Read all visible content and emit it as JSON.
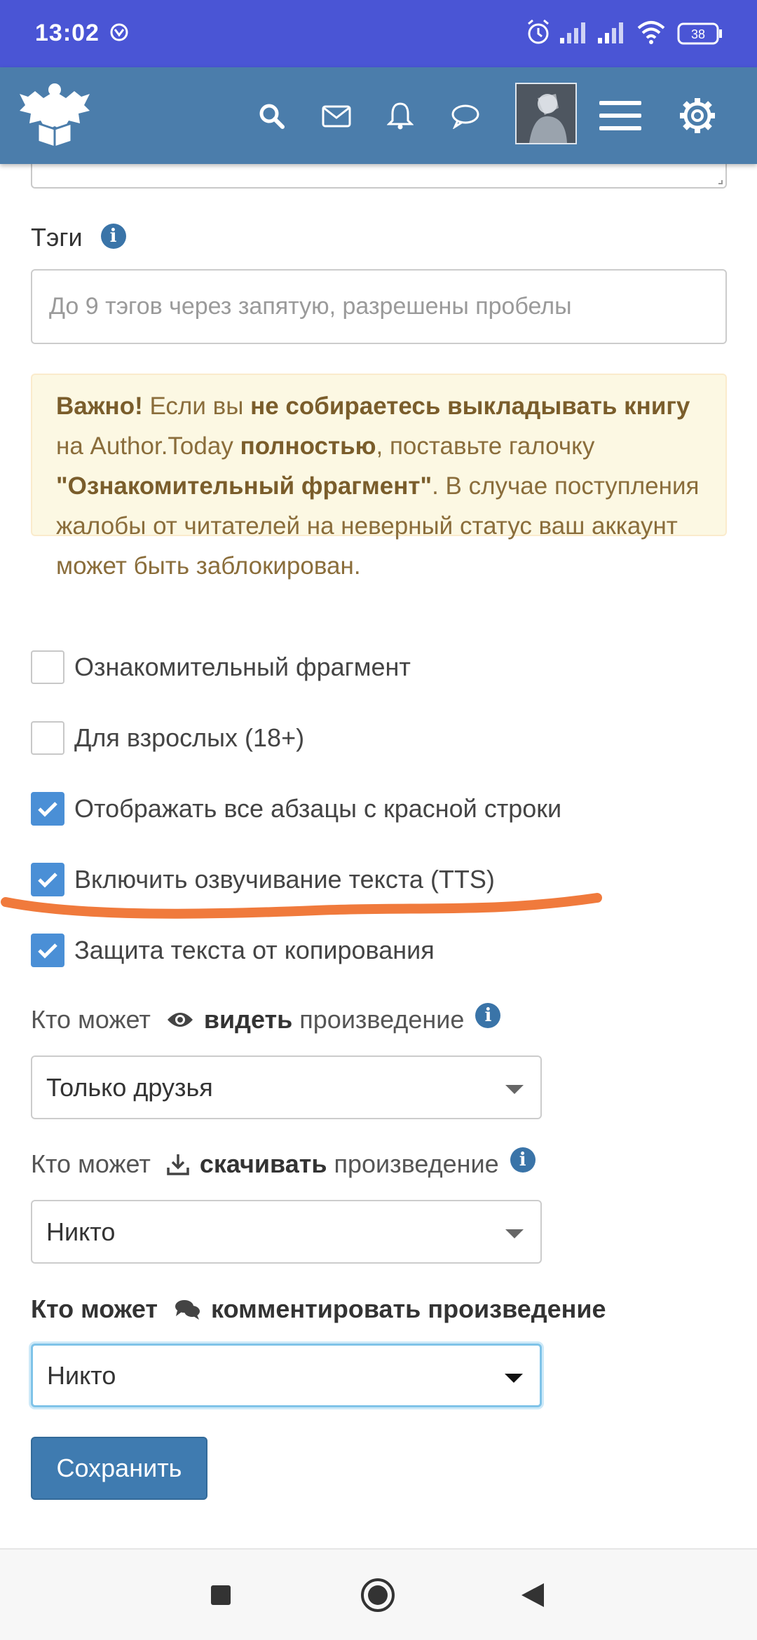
{
  "status_bar": {
    "time": "13:02",
    "battery": "38"
  },
  "header": {
    "nav_icons": [
      "search-icon",
      "mail-icon",
      "bell-icon",
      "chat-icon",
      "avatar",
      "menu-icon",
      "gear-icon"
    ]
  },
  "form": {
    "tags": {
      "label": "Тэги",
      "placeholder": "До 9 тэгов через запятую, разрешены пробелы"
    },
    "alert": {
      "p1": "Важно!",
      "p2": " Если вы ",
      "p3": "не собираетесь выкладывать книгу",
      "p4": " на Author.Today ",
      "p5": "полностью",
      "p6": ", поставьте галочку ",
      "p7": "\"Ознакомительный фрагмент\"",
      "p8": ". В случае поступления жалобы от читателей на неверный статус ваш аккаунт может быть заблокирован."
    },
    "checkboxes": [
      {
        "label": "Ознакомительный фрагмент",
        "checked": false
      },
      {
        "label": "Для взрослых (18+)",
        "checked": false
      },
      {
        "label": "Отображать все абзацы с красной строки",
        "checked": true
      },
      {
        "label": "Включить озвучивание текста (TTS)",
        "checked": true
      },
      {
        "label": "Защита текста от копирования",
        "checked": true
      }
    ],
    "view": {
      "prefix": "Кто может",
      "verb": "видеть",
      "suffix": "произведение",
      "value": "Только друзья"
    },
    "download": {
      "prefix": "Кто может",
      "verb": "скачивать",
      "suffix": "произведение",
      "value": "Никто"
    },
    "comment": {
      "prefix": "Кто может",
      "verb": "комментировать",
      "suffix": "произведение",
      "value": "Никто"
    },
    "save_label": "Сохранить"
  },
  "colors": {
    "status_bar": "#4a55d5",
    "header": "#4b7dab",
    "checkbox_on": "#4a8fd6",
    "annotation": "#f07a3c",
    "button": "#3f7bb0"
  }
}
